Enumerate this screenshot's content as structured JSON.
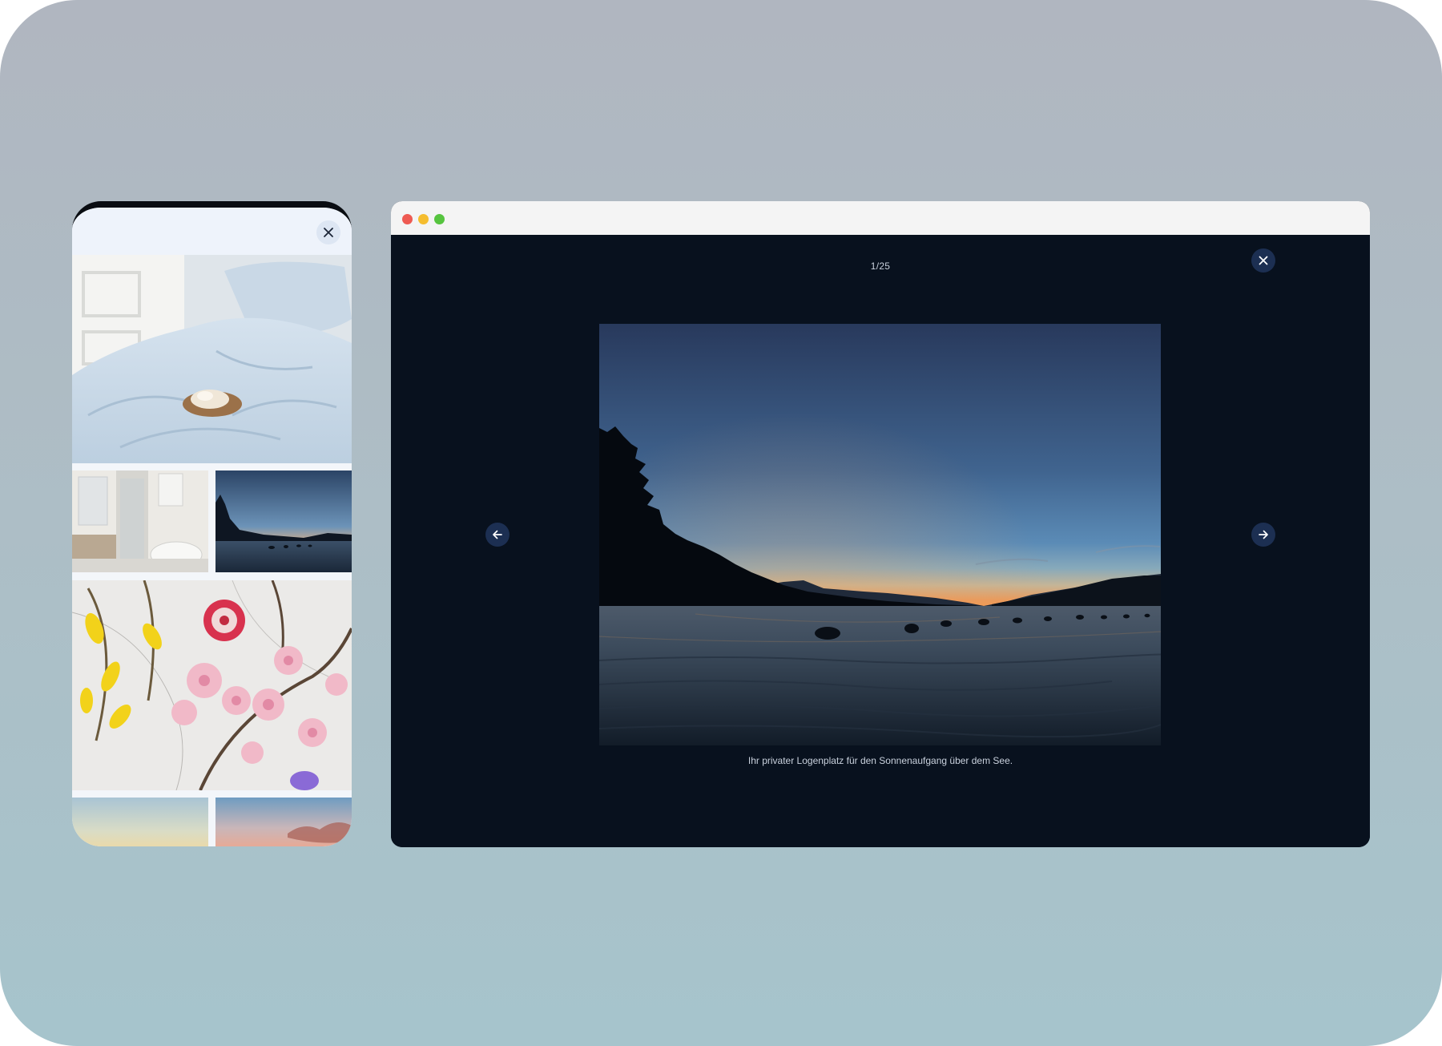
{
  "phone": {
    "close_icon": "close-icon",
    "gallery": [
      {
        "name": "bedroom-linen-photo"
      },
      {
        "name": "bathroom-photo"
      },
      {
        "name": "lake-sunset-thumbnail"
      },
      {
        "name": "flowers-photo"
      },
      {
        "name": "sky-photo-left"
      },
      {
        "name": "sky-photo-right"
      }
    ]
  },
  "browser": {
    "traffic_lights": {
      "close": "#ee5a52",
      "minimize": "#f5bd2f",
      "zoom": "#56c43f"
    },
    "viewer": {
      "counter": "1/25",
      "caption": "Ihr privater Logenplatz für den Sonnenaufgang über dem See.",
      "icons": {
        "close": "close-icon",
        "previous": "arrow-left-icon",
        "next": "arrow-right-icon"
      }
    }
  },
  "colors": {
    "viewer_bg": "#08111e",
    "button_bg": "#1c2f52",
    "phone_header": "#eef3fb"
  }
}
